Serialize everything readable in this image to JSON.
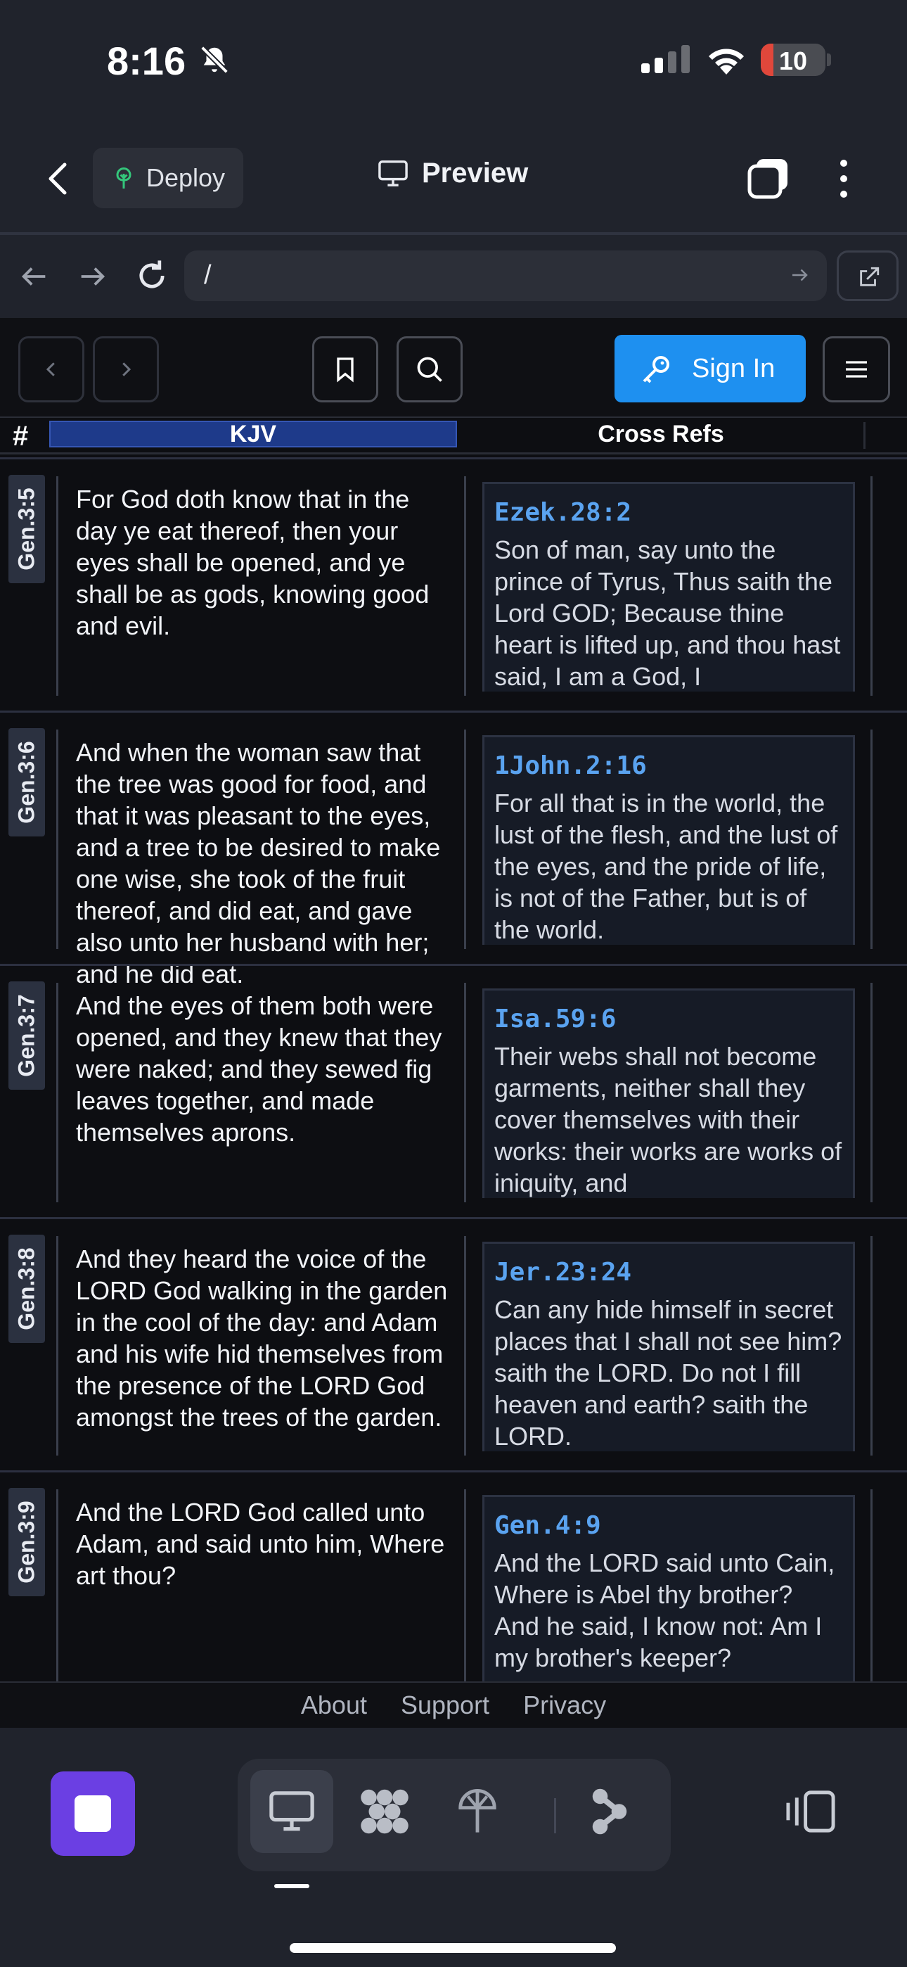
{
  "status_bar": {
    "time": "8:16",
    "battery": "10"
  },
  "host_bar": {
    "deploy_label": "Deploy",
    "preview_label": "Preview"
  },
  "browser_bar": {
    "url": "/"
  },
  "app_header": {
    "sign_in_label": "Sign In"
  },
  "table_header": {
    "hash": "#",
    "kjv": "KJV",
    "cross_refs": "Cross Refs"
  },
  "rows": [
    {
      "ref": "Gen.3:5",
      "verse": "For God doth know that in the day ye eat thereof, then your eyes shall be opened, and ye shall be as gods, knowing good and evil.",
      "xref": "Ezek.28:2",
      "xref_text": "Son of man, say unto the prince of Tyrus, Thus saith the Lord GOD; Because thine heart is lifted up, and thou hast said, I am a God, I"
    },
    {
      "ref": "Gen.3:6",
      "verse": "And when the woman saw that the tree was good for food, and that it was pleasant to the eyes, and a tree to be desired to make one wise, she took of the fruit thereof, and did eat, and gave also unto her husband with her; and he did eat.",
      "xref": "1John.2:16",
      "xref_text": "For all that is in the world, the lust of the flesh, and the lust of the eyes, and the pride of life, is not of the Father, but is of the world."
    },
    {
      "ref": "Gen.3:7",
      "verse": "And the eyes of them both were opened, and they knew that they were naked; and they sewed fig leaves together, and made themselves aprons.",
      "xref": "Isa.59:6",
      "xref_text": "Their webs shall not become garments, neither shall they cover themselves with their works: their works are works of iniquity, and"
    },
    {
      "ref": "Gen.3:8",
      "verse": "And they heard the voice of the LORD God walking in the garden in the cool of the day: and Adam and his wife hid themselves from the presence of the LORD God amongst the trees of the garden.",
      "xref": "Jer.23:24",
      "xref_text": "Can any hide himself in secret places that I shall not see him? saith the LORD. Do not I fill heaven and earth? saith the LORD."
    },
    {
      "ref": "Gen.3:9",
      "verse": "And the LORD God called unto Adam, and said unto him, Where art thou?",
      "xref": "Gen.4:9",
      "xref_text": "And the LORD said unto Cain, Where is Abel thy brother? And he said, I know not: Am I my brother's keeper?"
    }
  ],
  "footer": {
    "about": "About",
    "support": "Support",
    "privacy": "Privacy"
  },
  "colors": {
    "accent_blue": "#1e90f0",
    "kjv_header": "#1e3a8a",
    "xref_link": "#5aa3f0",
    "stop_purple": "#6b3fe3"
  },
  "icons": [
    "bell-slash-icon",
    "signal-icon",
    "wifi-icon",
    "tree-icon",
    "monitor-icon",
    "tabs-icon",
    "more-icon",
    "bookmark-icon",
    "search-icon",
    "key-icon",
    "menu-icon",
    "grid-icon",
    "deploy-icon",
    "share-icon",
    "sidebar-icon"
  ]
}
